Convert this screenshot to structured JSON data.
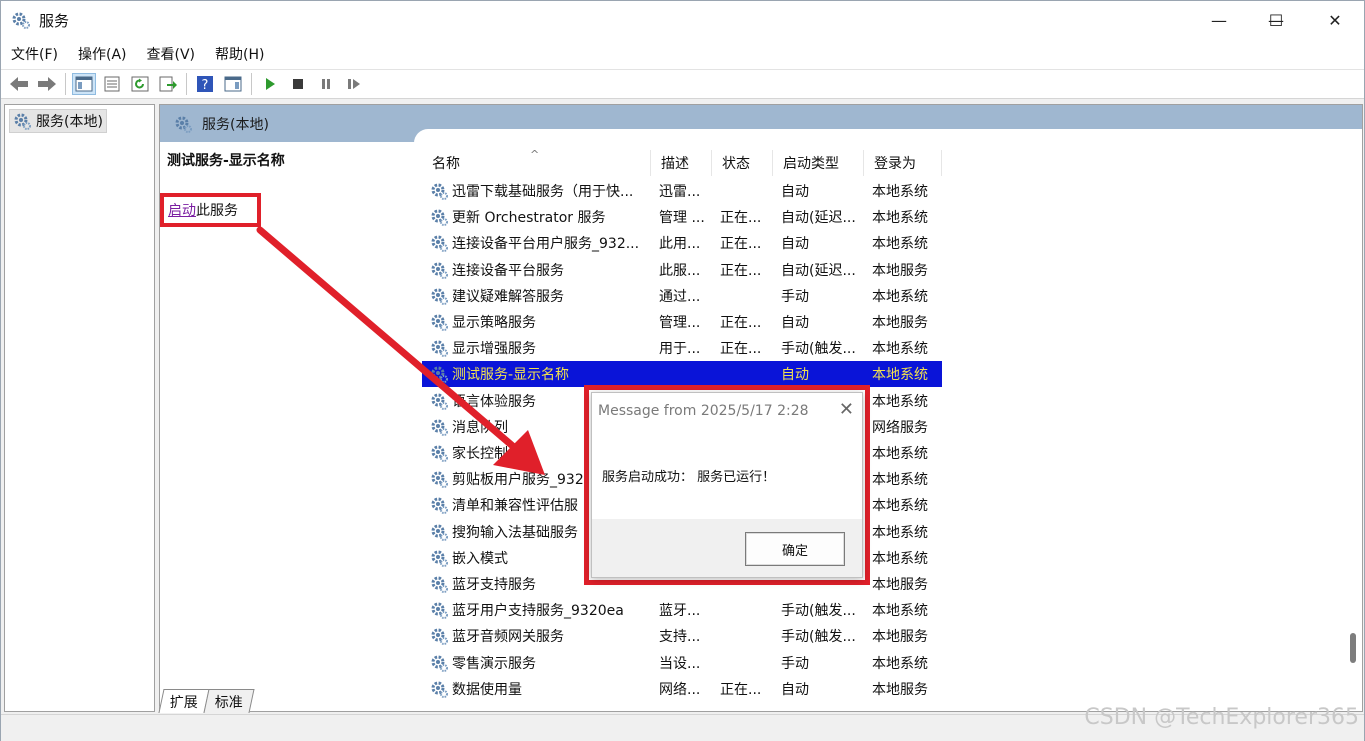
{
  "window": {
    "title": "服务"
  },
  "window_controls": {
    "minimize": "—",
    "maximize": "☐",
    "close": "✕"
  },
  "menu": [
    "文件(F)",
    "操作(A)",
    "查看(V)",
    "帮助(H)"
  ],
  "tree": {
    "root_label": "服务(本地)"
  },
  "pane": {
    "header_label": "服务(本地)"
  },
  "details": {
    "title": "测试服务-显示名称",
    "start_link": "启动",
    "start_suffix": "此服务"
  },
  "columns": {
    "name": "名称",
    "desc": "描述",
    "status": "状态",
    "start_type": "启动类型",
    "logon": "登录为"
  },
  "rows": [
    {
      "name": "迅雷下载基础服务（用于快...",
      "desc": "迅雷...",
      "status": "",
      "start": "自动",
      "logon": "本地系统"
    },
    {
      "name": "更新 Orchestrator 服务",
      "desc": "管理 ...",
      "status": "正在...",
      "start": "自动(延迟...",
      "logon": "本地系统"
    },
    {
      "name": "连接设备平台用户服务_932...",
      "desc": "此用...",
      "status": "正在...",
      "start": "自动",
      "logon": "本地系统"
    },
    {
      "name": "连接设备平台服务",
      "desc": "此服...",
      "status": "正在...",
      "start": "自动(延迟...",
      "logon": "本地服务"
    },
    {
      "name": "建议疑难解答服务",
      "desc": "通过...",
      "status": "",
      "start": "手动",
      "logon": "本地系统"
    },
    {
      "name": "显示策略服务",
      "desc": "管理...",
      "status": "正在...",
      "start": "自动",
      "logon": "本地服务"
    },
    {
      "name": "显示增强服务",
      "desc": "用于...",
      "status": "正在...",
      "start": "手动(触发...",
      "logon": "本地系统"
    },
    {
      "name": "测试服务-显示名称",
      "desc": "",
      "status": "",
      "start": "自动",
      "logon": "本地系统",
      "selected": true
    },
    {
      "name": "语言体验服务",
      "desc": "",
      "status": "",
      "start": "",
      "logon": "本地系统"
    },
    {
      "name": "消息队列",
      "desc": "",
      "status": "",
      "start": "",
      "logon": "网络服务"
    },
    {
      "name": "家长控制",
      "desc": "",
      "status": "",
      "start": "",
      "logon": "本地系统"
    },
    {
      "name": "剪贴板用户服务_932",
      "desc": "",
      "status": "",
      "start": "",
      "logon": "本地系统"
    },
    {
      "name": "清单和兼容性评估服",
      "desc": "",
      "status": "",
      "start": "",
      "logon": "本地系统"
    },
    {
      "name": "搜狗输入法基础服务",
      "desc": "",
      "status": "",
      "start": "",
      "logon": "本地系统"
    },
    {
      "name": "嵌入模式",
      "desc": "",
      "status": "",
      "start": "",
      "logon": "本地系统"
    },
    {
      "name": "蓝牙支持服务",
      "desc": "",
      "status": "",
      "start": "",
      "logon": "本地服务"
    },
    {
      "name": "蓝牙用户支持服务_9320ea",
      "desc": "蓝牙...",
      "status": "",
      "start": "手动(触发...",
      "logon": "本地系统"
    },
    {
      "name": "蓝牙音频网关服务",
      "desc": "支持...",
      "status": "",
      "start": "手动(触发...",
      "logon": "本地服务"
    },
    {
      "name": "零售演示服务",
      "desc": "当设...",
      "status": "",
      "start": "手动",
      "logon": "本地系统"
    },
    {
      "name": "数据使用量",
      "desc": "网络...",
      "status": "正在...",
      "start": "自动",
      "logon": "本地服务"
    }
  ],
  "tabs": [
    "扩展",
    "标准"
  ],
  "dialog": {
    "title": "Message from  2025/5/17 2:28",
    "message": "服务启动成功：  服务已运行！",
    "ok_label": "确定",
    "close": "✕"
  },
  "watermark": "CSDN @TechExplorer365",
  "colors": {
    "highlight": "#e0202a",
    "selection": "#0a14d8",
    "header_bar": "#9fb7d0"
  }
}
